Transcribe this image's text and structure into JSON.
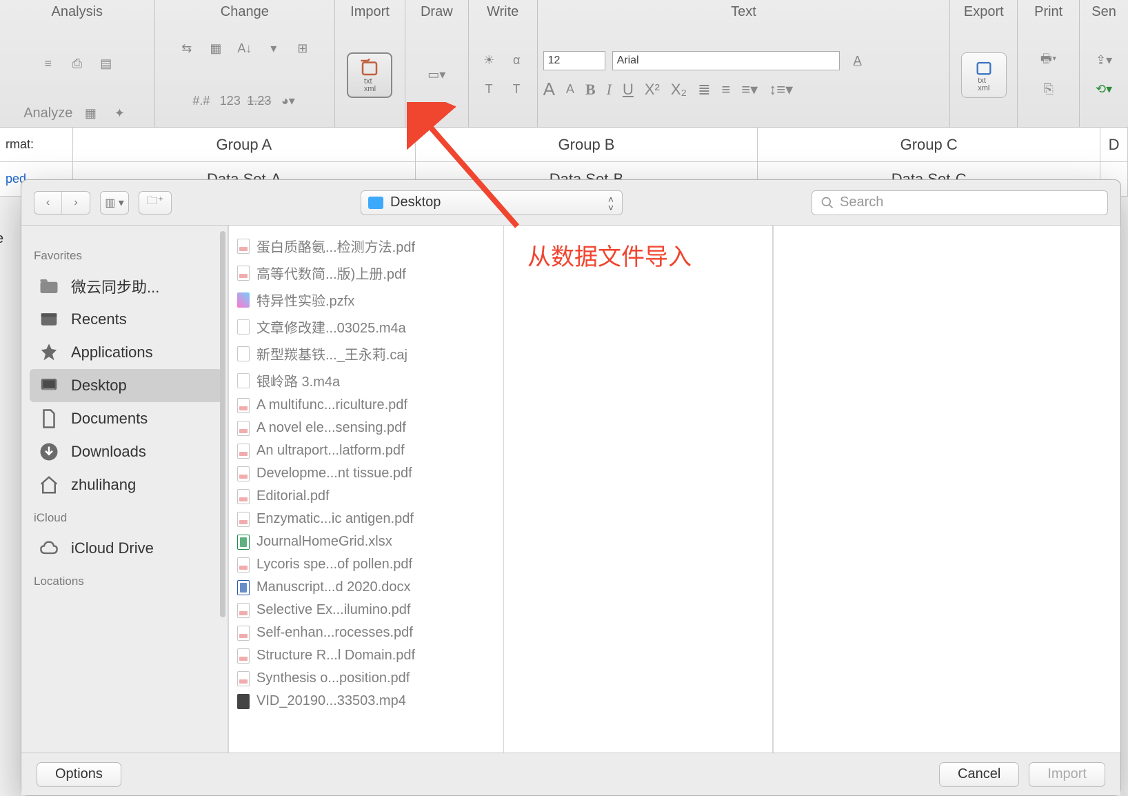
{
  "ribbon": {
    "groups": {
      "analysis": "Analysis",
      "change": "Change",
      "import": "Import",
      "draw": "Draw",
      "write": "Write",
      "text": "Text",
      "export": "Export",
      "print": "Print",
      "send": "Sen"
    },
    "analyze_label": "Analyze",
    "font_size": "12",
    "font_name": "Arial",
    "import_btn": "txt\nxml",
    "export_btn": "txt\nxml",
    "text_icons": {
      "enlarge": "A",
      "shrink": "A",
      "bold": "B",
      "italic": "I",
      "underline": "U",
      "sup": "X²",
      "sub": "X₂",
      "alpha": "α",
      "t_upper": "T",
      "t_lower": "T",
      "a_color": "A"
    },
    "change_labels": {
      "decimals": "123",
      "slash": "1.23",
      "hash": "#.#"
    }
  },
  "sheet": {
    "format_label": "rmat:",
    "ped_label": "ped",
    "groups": [
      "Group A",
      "Group B",
      "Group C"
    ],
    "datasets": [
      "Data Set-A",
      "Data Set-B",
      "Data Set-C"
    ],
    "right_edge": "D"
  },
  "ghost_left": "e",
  "dialog": {
    "location": "Desktop",
    "search_placeholder": "Search",
    "sidebar": {
      "favorites": "Favorites",
      "icloud": "iCloud",
      "locations": "Locations",
      "items": [
        {
          "label": "微云同步助...",
          "icon": "folder"
        },
        {
          "label": "Recents",
          "icon": "recents"
        },
        {
          "label": "Applications",
          "icon": "apps"
        },
        {
          "label": "Desktop",
          "icon": "desktop",
          "selected": true
        },
        {
          "label": "Documents",
          "icon": "doc"
        },
        {
          "label": "Downloads",
          "icon": "downloads"
        },
        {
          "label": "zhulihang",
          "icon": "home"
        }
      ],
      "icloud_items": [
        {
          "label": "iCloud Drive",
          "icon": "cloud"
        }
      ]
    },
    "files": [
      {
        "name": "蛋白质酪氨...检测方法.pdf",
        "t": "pdf"
      },
      {
        "name": "高等代数简...版)上册.pdf",
        "t": "pdf"
      },
      {
        "name": "特异性实验.pzfx",
        "t": "pz"
      },
      {
        "name": "文章修改建...03025.m4a",
        "t": "mus"
      },
      {
        "name": "新型羰基铁..._王永莉.caj",
        "t": "file"
      },
      {
        "name": "银岭路 3.m4a",
        "t": "mus"
      },
      {
        "name": "A multifunc...riculture.pdf",
        "t": "pdf"
      },
      {
        "name": "A novel ele...sensing.pdf",
        "t": "pdf"
      },
      {
        "name": "An ultraport...latform.pdf",
        "t": "pdf"
      },
      {
        "name": "Developme...nt tissue.pdf",
        "t": "pdf"
      },
      {
        "name": "Editorial.pdf",
        "t": "pdf"
      },
      {
        "name": "Enzymatic...ic antigen.pdf",
        "t": "pdf"
      },
      {
        "name": "JournalHomeGrid.xlsx",
        "t": "xls"
      },
      {
        "name": "Lycoris spe...of pollen.pdf",
        "t": "pdf"
      },
      {
        "name": "Manuscript...d 2020.docx",
        "t": "doc"
      },
      {
        "name": "Selective Ex...ilumino.pdf",
        "t": "pdf"
      },
      {
        "name": "Self-enhan...rocesses.pdf",
        "t": "pdf"
      },
      {
        "name": "Structure R...l Domain.pdf",
        "t": "pdf"
      },
      {
        "name": "Synthesis o...position.pdf",
        "t": "pdf"
      },
      {
        "name": "VID_20190...33503.mp4",
        "t": "vid"
      }
    ],
    "buttons": {
      "options": "Options",
      "cancel": "Cancel",
      "import": "Import"
    }
  },
  "annotation": "从数据文件导入"
}
